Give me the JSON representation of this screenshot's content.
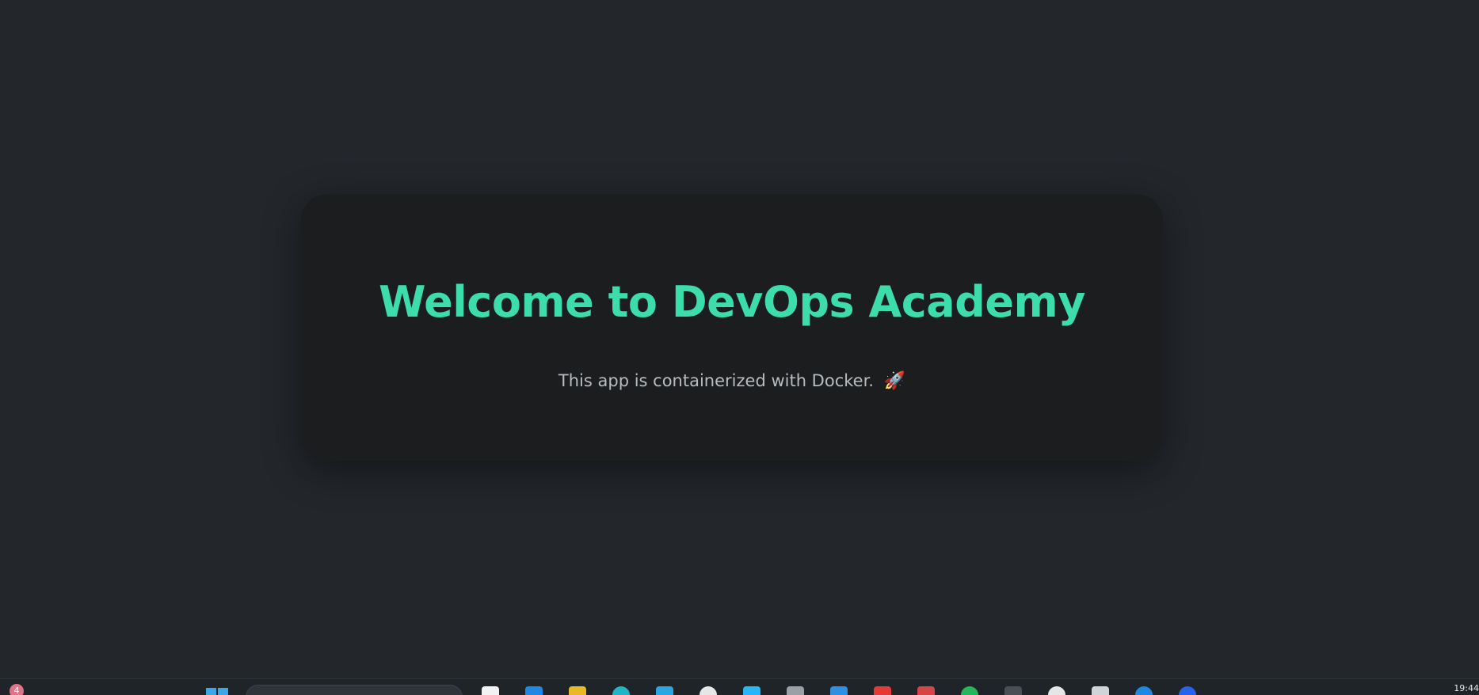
{
  "main": {
    "title": "Welcome to DevOps Academy",
    "subtitle": "This app is containerized with Docker.",
    "subtitle_icon": "🚀"
  },
  "taskbar": {
    "notification_count": "4",
    "clock": "19:44",
    "pinned_apps": [
      {
        "name": "file-icon",
        "color": "#f2f2f2"
      },
      {
        "name": "edge-icon",
        "color": "#1e88e5"
      },
      {
        "name": "folder-icon",
        "color": "#e8b923"
      },
      {
        "name": "app-teal-icon",
        "color": "#1fb5c2"
      },
      {
        "name": "app-blue-icon",
        "color": "#2aa7e0"
      },
      {
        "name": "github-icon",
        "color": "#e6e6e6"
      },
      {
        "name": "app-diamond-icon",
        "color": "#29b6f6"
      },
      {
        "name": "terminal-icon",
        "color": "#9aa0a6"
      },
      {
        "name": "vscode-icon",
        "color": "#2f8fe0"
      },
      {
        "name": "browser-active-icon",
        "color": "#e53935"
      },
      {
        "name": "app-red-icon",
        "color": "#d64545"
      },
      {
        "name": "whatsapp-icon",
        "color": "#25b55b"
      },
      {
        "name": "app-dark-icon",
        "color": "#4a4f55"
      },
      {
        "name": "chrome-icon",
        "color": "#e6e6e6"
      },
      {
        "name": "app-outline-icon",
        "color": "#d0d4d8"
      },
      {
        "name": "app-blue2-icon",
        "color": "#1e88e5"
      },
      {
        "name": "app-blue3-icon",
        "color": "#2563eb"
      }
    ]
  },
  "colors": {
    "background": "#23272c",
    "card": "#1b1d1f",
    "accent": "#3ddcab",
    "subtitle": "#b7bcc1"
  }
}
